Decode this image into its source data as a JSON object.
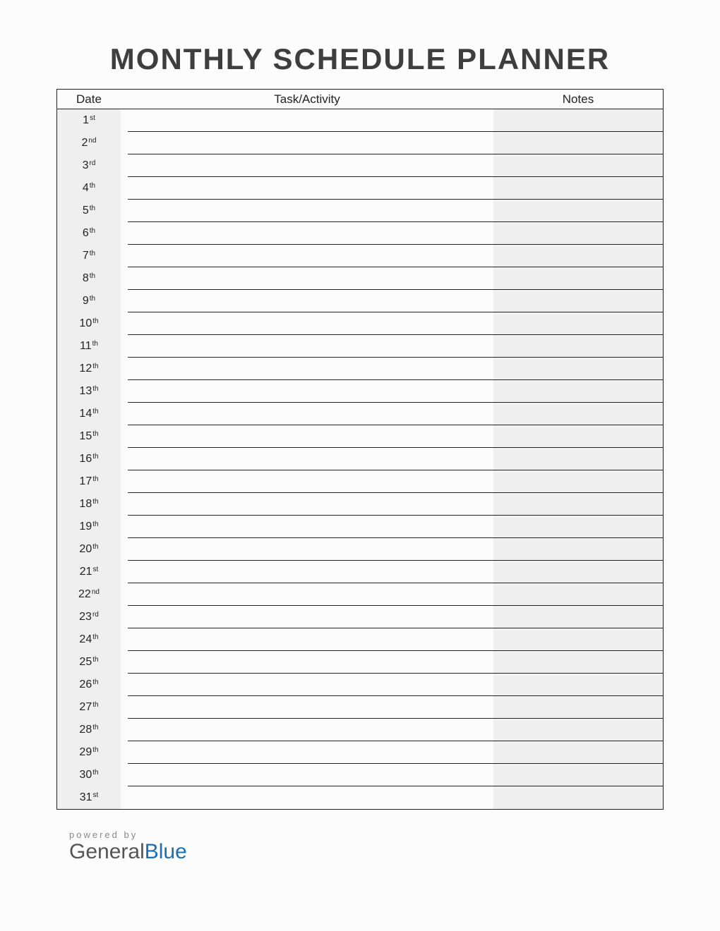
{
  "title": "MONTHLY SCHEDULE PLANNER",
  "columns": {
    "date": "Date",
    "task": "Task/Activity",
    "notes": "Notes"
  },
  "rows": [
    {
      "day": "1",
      "ordinal": "st",
      "task": "",
      "notes": ""
    },
    {
      "day": "2",
      "ordinal": "nd",
      "task": "",
      "notes": ""
    },
    {
      "day": "3",
      "ordinal": "rd",
      "task": "",
      "notes": ""
    },
    {
      "day": "4",
      "ordinal": "th",
      "task": "",
      "notes": ""
    },
    {
      "day": "5",
      "ordinal": "th",
      "task": "",
      "notes": ""
    },
    {
      "day": "6",
      "ordinal": "th",
      "task": "",
      "notes": ""
    },
    {
      "day": "7",
      "ordinal": "th",
      "task": "",
      "notes": ""
    },
    {
      "day": "8",
      "ordinal": "th",
      "task": "",
      "notes": ""
    },
    {
      "day": "9",
      "ordinal": "th",
      "task": "",
      "notes": ""
    },
    {
      "day": "10",
      "ordinal": "th",
      "task": "",
      "notes": ""
    },
    {
      "day": "11",
      "ordinal": "th",
      "task": "",
      "notes": ""
    },
    {
      "day": "12",
      "ordinal": "th",
      "task": "",
      "notes": ""
    },
    {
      "day": "13",
      "ordinal": "th",
      "task": "",
      "notes": ""
    },
    {
      "day": "14",
      "ordinal": "th",
      "task": "",
      "notes": ""
    },
    {
      "day": "15",
      "ordinal": "th",
      "task": "",
      "notes": ""
    },
    {
      "day": "16",
      "ordinal": "th",
      "task": "",
      "notes": ""
    },
    {
      "day": "17",
      "ordinal": "th",
      "task": "",
      "notes": ""
    },
    {
      "day": "18",
      "ordinal": "th",
      "task": "",
      "notes": ""
    },
    {
      "day": "19",
      "ordinal": "th",
      "task": "",
      "notes": ""
    },
    {
      "day": "20",
      "ordinal": "th",
      "task": "",
      "notes": ""
    },
    {
      "day": "21",
      "ordinal": "st",
      "task": "",
      "notes": ""
    },
    {
      "day": "22",
      "ordinal": "nd",
      "task": "",
      "notes": ""
    },
    {
      "day": "23",
      "ordinal": "rd",
      "task": "",
      "notes": ""
    },
    {
      "day": "24",
      "ordinal": "th",
      "task": "",
      "notes": ""
    },
    {
      "day": "25",
      "ordinal": "th",
      "task": "",
      "notes": ""
    },
    {
      "day": "26",
      "ordinal": "th",
      "task": "",
      "notes": ""
    },
    {
      "day": "27",
      "ordinal": "th",
      "task": "",
      "notes": ""
    },
    {
      "day": "28",
      "ordinal": "th",
      "task": "",
      "notes": ""
    },
    {
      "day": "29",
      "ordinal": "th",
      "task": "",
      "notes": ""
    },
    {
      "day": "30",
      "ordinal": "th",
      "task": "",
      "notes": ""
    },
    {
      "day": "31",
      "ordinal": "st",
      "task": "",
      "notes": ""
    }
  ],
  "footer": {
    "powered_by": "powered by",
    "brand_a": "General",
    "brand_b": "Blue"
  }
}
